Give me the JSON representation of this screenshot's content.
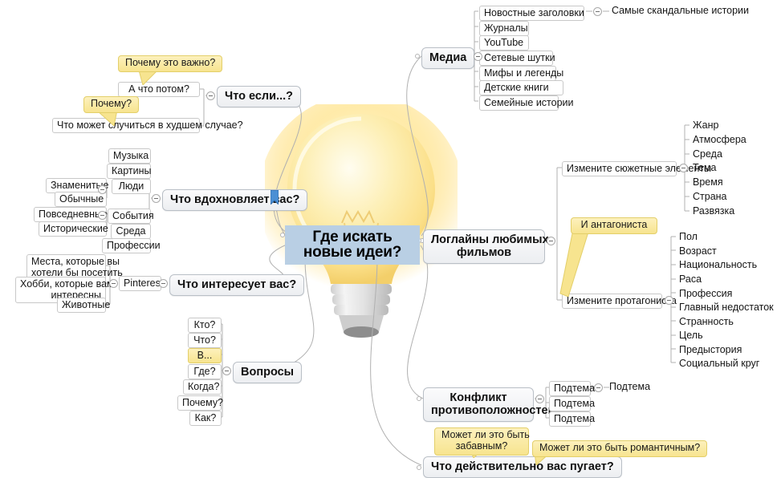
{
  "map": {
    "title": "Где искать новые идеи?",
    "central_bg": "#b9cfe4",
    "note_bg": "#f7e48f",
    "bulb_color": "#ffd24d"
  },
  "root": {
    "line1": "Где искать",
    "line2": "новые идеи?"
  },
  "branches": {
    "what_if": {
      "label": "Что если...?",
      "children": [
        {
          "label": "А что потом?"
        },
        {
          "label": "Что может случиться в худшем случае?"
        }
      ],
      "notes": [
        {
          "label": "Почему это важно?"
        },
        {
          "label": "Почему?"
        }
      ]
    },
    "inspires": {
      "label": "Что вдохновляет вас?",
      "icon": "bookmark-icon",
      "children": [
        {
          "label": "Музыка"
        },
        {
          "label": "Картины"
        },
        {
          "label": "Люди",
          "children": [
            {
              "label": "Знаменитые"
            },
            {
              "label": "Обычные"
            }
          ]
        },
        {
          "label": "События",
          "children": [
            {
              "label": "Повседневные"
            },
            {
              "label": "Исторические"
            }
          ]
        },
        {
          "label": "Среда"
        },
        {
          "label": "Профессии"
        }
      ]
    },
    "interests": {
      "label": "Что интересует вас?",
      "children": [
        {
          "label": "Pinterest",
          "children": [
            {
              "line1": "Места, которые вы",
              "line2": "хотели бы посетить"
            },
            {
              "line1": "Хобби, которые вам",
              "line2": "интересны"
            },
            {
              "line1": "Животные"
            }
          ]
        }
      ]
    },
    "questions": {
      "label": "Вопросы",
      "children": [
        {
          "label": "Кто?"
        },
        {
          "label": "Что?"
        },
        {
          "label": "В...",
          "highlight": true
        },
        {
          "label": "Где?"
        },
        {
          "label": "Когда?"
        },
        {
          "label": "Почему?"
        },
        {
          "label": "Как?"
        }
      ]
    },
    "media": {
      "label": "Медиа",
      "children": [
        {
          "label": "Новостные заголовки",
          "children": [
            {
              "label": "Самые скандальные истории"
            }
          ]
        },
        {
          "label": "Журналы"
        },
        {
          "label": "YouTube"
        },
        {
          "label": "Сетевые шутки"
        },
        {
          "label": "Мифы и легенды"
        },
        {
          "label": "Детские книги"
        },
        {
          "label": "Семейные истории"
        }
      ]
    },
    "loglines": {
      "line1": "Логлайны любимых",
      "line2": "фильмов",
      "children": [
        {
          "label": "Измените сюжетные элементы",
          "children": [
            {
              "label": "Жанр"
            },
            {
              "label": "Атмосфера"
            },
            {
              "label": "Среда"
            },
            {
              "label": "Тема"
            },
            {
              "label": "Время"
            },
            {
              "label": "Страна"
            },
            {
              "label": "Развязка"
            }
          ]
        },
        {
          "label": "Измените протагониста",
          "note": "И антагониста",
          "children": [
            {
              "label": "Пол"
            },
            {
              "label": "Возраст"
            },
            {
              "label": "Национальность"
            },
            {
              "label": "Раса"
            },
            {
              "label": "Профессия"
            },
            {
              "label": "Главный недостаток"
            },
            {
              "label": "Странность"
            },
            {
              "label": "Цель"
            },
            {
              "label": "Предыстория"
            },
            {
              "label": "Социальный круг"
            }
          ]
        }
      ]
    },
    "conflict": {
      "line1": "Конфликт",
      "line2": "противоположностей",
      "children": [
        {
          "label": "Подтема",
          "children": [
            {
              "label": "Подтема"
            }
          ]
        },
        {
          "label": "Подтема"
        },
        {
          "label": "Подтема"
        }
      ]
    },
    "scares": {
      "label": "Что действительно вас пугает?",
      "notes": [
        {
          "line1": "Может ли это быть",
          "line2": "забавным?"
        },
        {
          "line1": "Может ли это быть романтичным?"
        }
      ]
    }
  }
}
